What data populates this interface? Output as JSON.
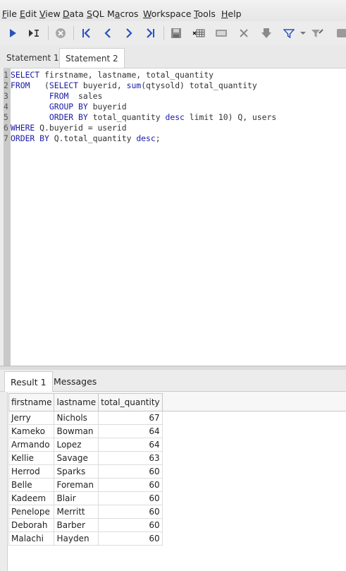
{
  "menu": [
    "File",
    "Edit",
    "View",
    "Data",
    "SQL",
    "Macros",
    "Workspace",
    "Tools",
    "Help"
  ],
  "statement_tabs": [
    "Statement 1",
    "Statement 2"
  ],
  "active_statement_tab": 1,
  "editor": {
    "line_numbers": [
      "1",
      "2",
      "3",
      "4",
      "5",
      "6",
      "7"
    ],
    "lines": [
      [
        [
          "k",
          "SELECT"
        ],
        [
          "t",
          " firstname, lastname, total_quantity"
        ]
      ],
      [
        [
          "k",
          "FROM"
        ],
        [
          "t",
          "   ("
        ],
        [
          "k",
          "SELECT"
        ],
        [
          "t",
          " buyerid, "
        ],
        [
          "k",
          "sum"
        ],
        [
          "t",
          "(qtysold) total_quantity"
        ]
      ],
      [
        [
          "t",
          "        "
        ],
        [
          "k",
          "FROM"
        ],
        [
          "t",
          "  sales"
        ]
      ],
      [
        [
          "t",
          "        "
        ],
        [
          "k",
          "GROUP BY"
        ],
        [
          "t",
          " buyerid"
        ]
      ],
      [
        [
          "t",
          "        "
        ],
        [
          "k",
          "ORDER BY"
        ],
        [
          "t",
          " total_quantity "
        ],
        [
          "k",
          "desc"
        ],
        [
          "t",
          " limit 10) Q, users"
        ]
      ],
      [
        [
          "k",
          "WHERE"
        ],
        [
          "t",
          " Q.buyerid = userid"
        ]
      ],
      [
        [
          "k",
          "ORDER BY"
        ],
        [
          "t",
          " Q.total_quantity "
        ],
        [
          "k",
          "desc"
        ],
        [
          "t",
          ";"
        ]
      ]
    ]
  },
  "result_tabs": [
    "Result 1",
    "Messages"
  ],
  "table": {
    "columns": [
      "firstname",
      "lastname",
      "total_quantity"
    ],
    "rows": [
      [
        "Jerry",
        "Nichols",
        "67"
      ],
      [
        "Kameko",
        "Bowman",
        "64"
      ],
      [
        "Armando",
        "Lopez",
        "64"
      ],
      [
        "Kellie",
        "Savage",
        "63"
      ],
      [
        "Herrod",
        "Sparks",
        "60"
      ],
      [
        "Belle",
        "Foreman",
        "60"
      ],
      [
        "Kadeem",
        "Blair",
        "60"
      ],
      [
        "Penelope",
        "Merritt",
        "60"
      ],
      [
        "Deborah",
        "Barber",
        "60"
      ],
      [
        "Malachi",
        "Hayden",
        "60"
      ]
    ]
  },
  "colors": {
    "keyword": "#1a1aa6",
    "run_icon": "#2a52be",
    "gutter": "#c9c9c9"
  },
  "toolbar_icons": [
    "execute-icon",
    "execute-current-icon",
    "stop-icon",
    "first-icon",
    "previous-icon",
    "next-icon",
    "last-icon",
    "save-icon",
    "add-row-icon",
    "edit-icon",
    "delete-icon",
    "commit-icon",
    "filter-icon",
    "clear-filter-icon",
    "more-icon"
  ]
}
